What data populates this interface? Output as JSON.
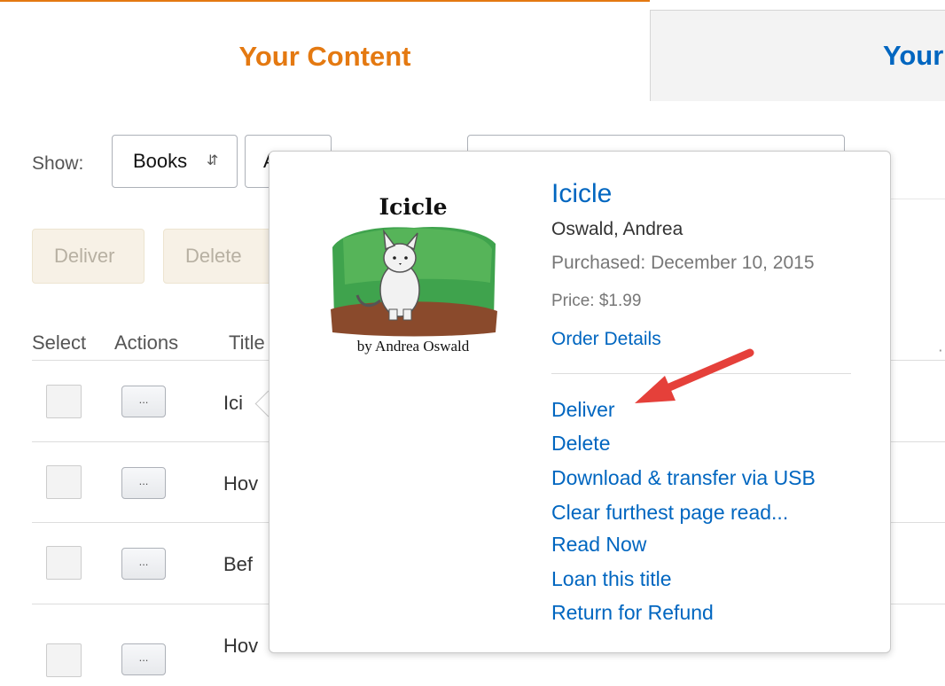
{
  "tabs": {
    "active_label": "Your Content",
    "inactive_label": "Your"
  },
  "filters": {
    "show_label": "Show:",
    "category_value": "Books",
    "second_select_value": "A"
  },
  "toolbar": {
    "deliver_label": "Deliver",
    "delete_label": "Delete"
  },
  "table": {
    "headers": [
      "Select",
      "Actions",
      "Title"
    ],
    "action_button_label": "...",
    "rows": [
      {
        "title": "Ici"
      },
      {
        "title": "Hov"
      },
      {
        "title": "Bef"
      },
      {
        "title": "Hov"
      }
    ],
    "trailing_text": "..."
  },
  "popover": {
    "cover_title": "Icicle",
    "cover_author": "by Andrea Oswald",
    "title": "Icicle",
    "author": "Oswald, Andrea",
    "purchased": "Purchased: December 10, 2015",
    "price": "Price: $1.99",
    "order_details": "Order Details",
    "actions": [
      "Deliver",
      "Delete",
      "Download & transfer via USB",
      "Clear furthest page read...",
      "Read Now",
      "Loan this title",
      "Return for Refund"
    ]
  },
  "colors": {
    "accent_orange": "#e47911",
    "link_blue": "#0066c0",
    "annotation_arrow": "#e5403a"
  }
}
